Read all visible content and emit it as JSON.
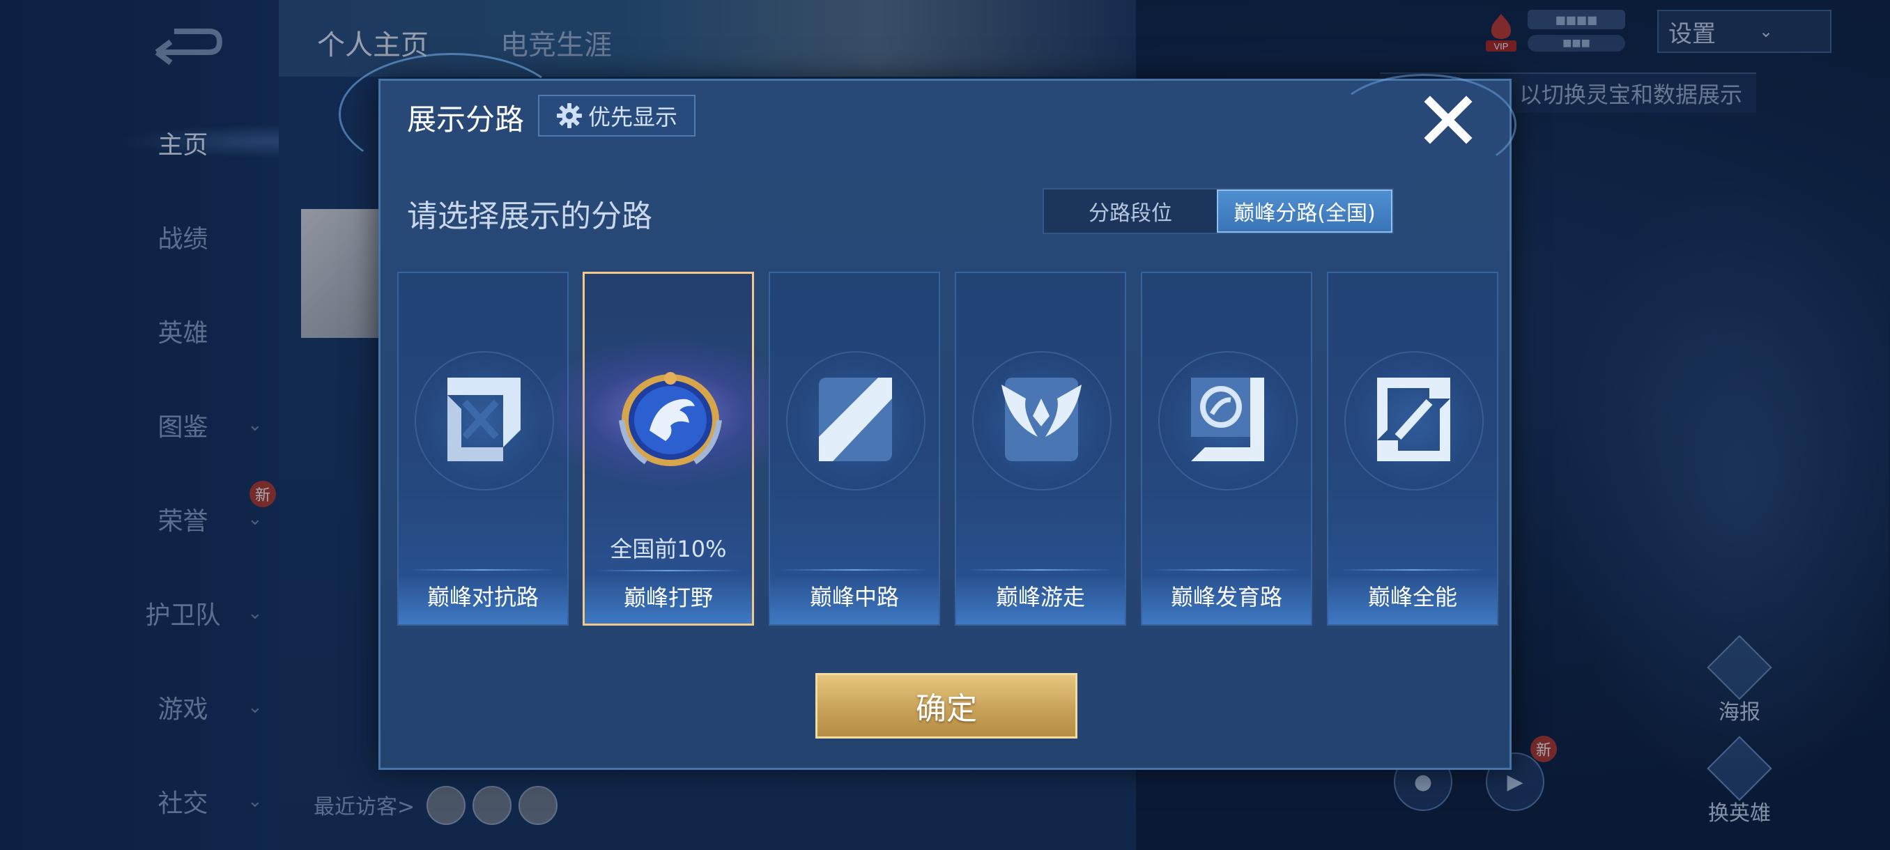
{
  "nav": {
    "items": [
      {
        "label": "主页",
        "active": true,
        "chevron": false
      },
      {
        "label": "战绩",
        "active": false,
        "chevron": false
      },
      {
        "label": "英雄",
        "active": false,
        "chevron": false
      },
      {
        "label": "图鉴",
        "active": false,
        "chevron": true
      },
      {
        "label": "荣誉",
        "active": false,
        "chevron": true
      },
      {
        "label": "护卫队",
        "active": false,
        "chevron": true
      },
      {
        "label": "游戏",
        "active": false,
        "chevron": true
      },
      {
        "label": "社交",
        "active": false,
        "chevron": true
      }
    ],
    "new_badge": "新"
  },
  "profile": {
    "tabs": [
      "个人主页",
      "电竞生涯"
    ],
    "visitors_label": "最近访客>"
  },
  "header": {
    "vip_label": "VIP",
    "settings_label": "设置",
    "tip_text": "以切换灵宝和数据展示"
  },
  "side_actions": {
    "poster": "海报",
    "switch_hero": "换英雄",
    "new_badge": "新"
  },
  "modal": {
    "title": "展示分路",
    "priority_label": "优先显示",
    "prompt": "请选择展示的分路",
    "segment": {
      "options": [
        "分路段位",
        "巅峰分路(全国)"
      ],
      "selected": 1
    },
    "roles": [
      {
        "name": "巅峰对抗路",
        "icon": "clash-lane-icon",
        "selected": false,
        "rank": ""
      },
      {
        "name": "巅峰打野",
        "icon": "jungle-dragon-emblem-icon",
        "selected": true,
        "rank": "全国前10%"
      },
      {
        "name": "巅峰中路",
        "icon": "mid-lane-icon",
        "selected": false,
        "rank": ""
      },
      {
        "name": "巅峰游走",
        "icon": "roam-wings-icon",
        "selected": false,
        "rank": ""
      },
      {
        "name": "巅峰发育路",
        "icon": "farm-lane-icon",
        "selected": false,
        "rank": ""
      },
      {
        "name": "巅峰全能",
        "icon": "all-round-icon",
        "selected": false,
        "rank": ""
      }
    ],
    "confirm_label": "确定"
  },
  "colors": {
    "accent_gold": "#f3c98a",
    "segment_active": "#3a74b6",
    "confirm_gold": "#c9a25a"
  }
}
